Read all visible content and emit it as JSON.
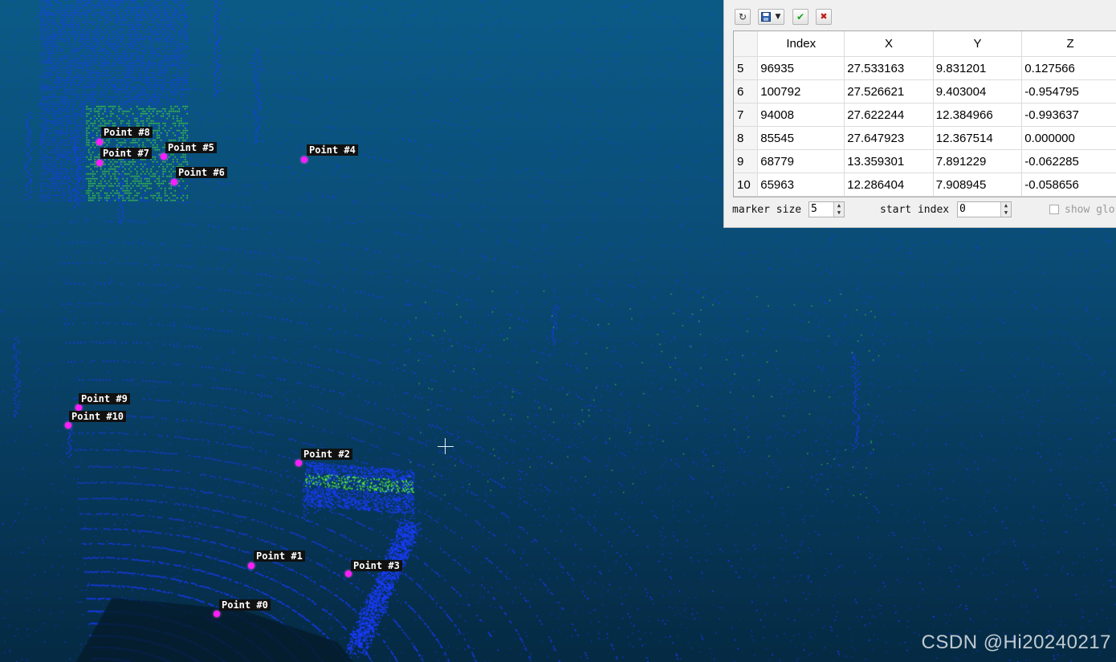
{
  "viewer": {
    "picked_points": [
      {
        "label": "Point #0"
      },
      {
        "label": "Point #1"
      },
      {
        "label": "Point #2"
      },
      {
        "label": "Point #3"
      },
      {
        "label": "Point #4"
      },
      {
        "label": "Point #5"
      },
      {
        "label": "Point #6"
      },
      {
        "label": "Point #7"
      },
      {
        "label": "Point #8"
      },
      {
        "label": "Point #9"
      },
      {
        "label": "Point #10"
      }
    ],
    "watermark": "CSDN @Hi20240217",
    "colors": {
      "background_top": "#0b5a86",
      "background_bottom": "#052a43",
      "scan_points": "#1a3cff",
      "highlight_points": "#5cff3a",
      "picked_marker": "#ff1cff"
    }
  },
  "panel": {
    "toolbar": {
      "reset_icon": "reset-icon",
      "save_icon": "save-icon",
      "save_dropdown_icon": "chevron-down-icon",
      "ok_icon": "check-icon",
      "cancel_icon": "close-icon"
    },
    "table": {
      "headers": [
        "Index",
        "X",
        "Y",
        "Z"
      ],
      "rows": [
        {
          "row": "5",
          "index": "96935",
          "x": "27.533163",
          "y": "9.831201",
          "z": "0.127566"
        },
        {
          "row": "6",
          "index": "100792",
          "x": "27.526621",
          "y": "9.403004",
          "z": "-0.954795"
        },
        {
          "row": "7",
          "index": "94008",
          "x": "27.622244",
          "y": "12.384966",
          "z": "-0.993637"
        },
        {
          "row": "8",
          "index": "85545",
          "x": "27.647923",
          "y": "12.367514",
          "z": "0.000000"
        },
        {
          "row": "9",
          "index": "68779",
          "x": "13.359301",
          "y": "7.891229",
          "z": "-0.062285"
        },
        {
          "row": "10",
          "index": "65963",
          "x": "12.286404",
          "y": "7.908945",
          "z": "-0.058656"
        }
      ]
    },
    "controls": {
      "marker_size_label": "marker size",
      "marker_size_value": "5",
      "start_index_label": "start index",
      "start_index_value": "0",
      "show_global_label": "show glo"
    }
  }
}
